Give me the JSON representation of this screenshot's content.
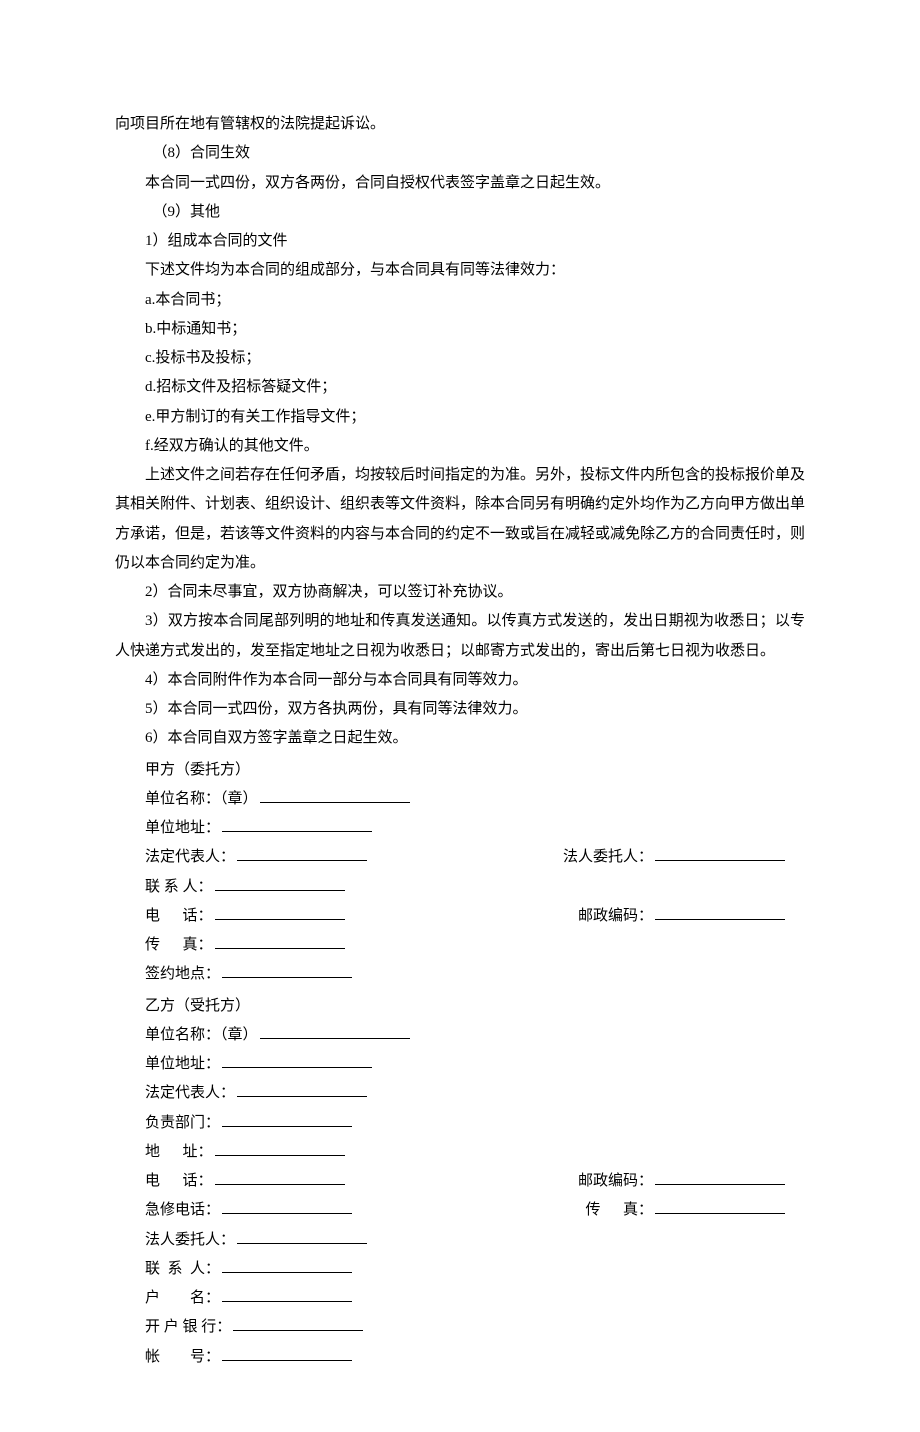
{
  "body": [
    "向项目所在地有管辖权的法院提起诉讼。",
    "（8）合同生效",
    "本合同一式四份，双方各两份，合同自授权代表签字盖章之日起生效。",
    "（9）其他",
    "1）组成本合同的文件",
    "下述文件均为本合同的组成部分，与本合同具有同等法律效力：",
    "a.本合同书；",
    "b.中标通知书；",
    "c.投标书及投标；",
    "d.招标文件及招标答疑文件；",
    "e.甲方制订的有关工作指导文件；",
    "f.经双方确认的其他文件。",
    "上述文件之间若存在任何矛盾，均按较后时间指定的为准。另外，投标文件内所包含的投标报价单及其相关附件、计划表、组织设计、组织表等文件资料，除本合同另有明确约定外均作为乙方向甲方做出单方承诺，但是，若该等文件资料的内容与本合同的约定不一致或旨在减轻或减免除乙方的合同责任时，则仍以本合同约定为准。",
    "2）合同未尽事宜，双方协商解决，可以签订补充协议。",
    "3）双方按本合同尾部列明的地址和传真发送通知。以传真方式发送的，发出日期视为收悉日；以专人快递方式发出的，发至指定地址之日视为收悉日；以邮寄方式发出的，寄出后第七日视为收悉日。",
    "4）本合同附件作为本合同一部分与本合同具有同等效力。",
    "5）本合同一式四份，双方各执两份，具有同等法律效力。",
    "6）本合同自双方签字盖章之日起生效。"
  ],
  "sig": {
    "partyA": {
      "header": "甲方（委托方）",
      "unitName": "单位名称：（章）",
      "unitAddr": "单位地址：",
      "legalRep": "法定代表人：",
      "legalAgent": "法人委托人：",
      "contact": "联 系 人：",
      "phone": "电      话：",
      "postcode": "邮政编码：",
      "fax": "传      真：",
      "signPlace": "签约地点："
    },
    "partyB": {
      "header": "乙方（受托方）",
      "unitName": "单位名称：（章）",
      "unitAddr": "单位地址：",
      "legalRep": "法定代表人：",
      "dept": "负责部门：",
      "addr": "地      址：",
      "phone": "电      话：",
      "postcode": "邮政编码：",
      "emerg": "急修电话：",
      "fax": "传      真：",
      "legalAgent": "法人委托人：",
      "contact": "联  系  人：",
      "acctName": "户        名：",
      "bank": "开 户 银 行：",
      "acctNo": "帐        号："
    }
  }
}
